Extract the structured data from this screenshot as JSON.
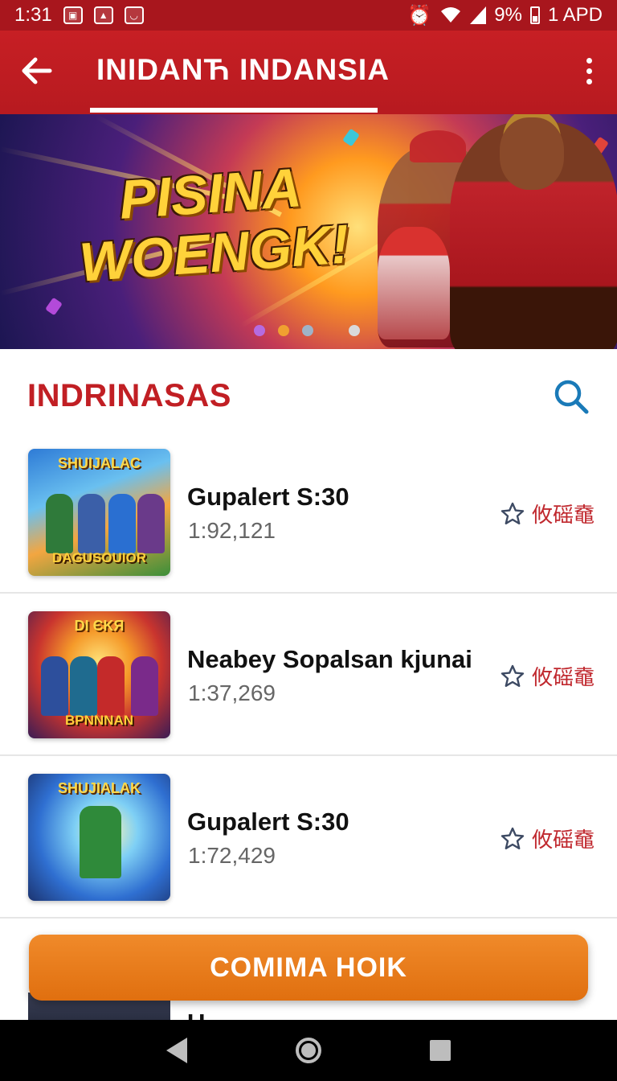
{
  "status_bar": {
    "time": "1:31",
    "right_text": "9%",
    "carrier": "1 APD",
    "icons": [
      "notification-icon",
      "photo-icon",
      "app-icon",
      "alarm-icon",
      "wifi-icon",
      "signal-icon",
      "battery-icon"
    ]
  },
  "app_bar": {
    "title": "INIDANЋ INDANSIA",
    "back_icon": "arrow-left-icon",
    "menu_icon": "more-vert-icon"
  },
  "banner": {
    "headline_line1": "PISINA",
    "headline_line2": "WOENGK!",
    "dots": [
      "#b56be0",
      "#f0a030",
      "#9fb3c8",
      "#d9d9d9"
    ],
    "active_dot": 1
  },
  "section": {
    "title": "INDRINASAS",
    "search_icon": "search-icon"
  },
  "items": [
    {
      "title": "Gupalert S:30",
      "meta": "1:92,121",
      "fav_label": "攸磘鼀",
      "thumb_title": "SHUIJALAC",
      "thumb_sub": "DAGUSOUIOR"
    },
    {
      "title": "Neabey Sopalsan kjunai",
      "meta": "1:37,269",
      "fav_label": "攸磘鼀",
      "thumb_title": "DI ЄKЯ",
      "thumb_sub": "BPNNNAN"
    },
    {
      "title": "Gupalert S:30",
      "meta": "1:72,429",
      "fav_label": "攸磘鼀",
      "thumb_title": "SHUJIALAK",
      "thumb_sub": ""
    }
  ],
  "peek_item": {
    "title": "U..."
  },
  "cta": {
    "label": "COMIMA HOIK"
  },
  "colors": {
    "primary_red": "#c71f24",
    "status_red": "#a8161d",
    "accent_orange": "#e8781c",
    "search_blue": "#1a7ab8"
  }
}
